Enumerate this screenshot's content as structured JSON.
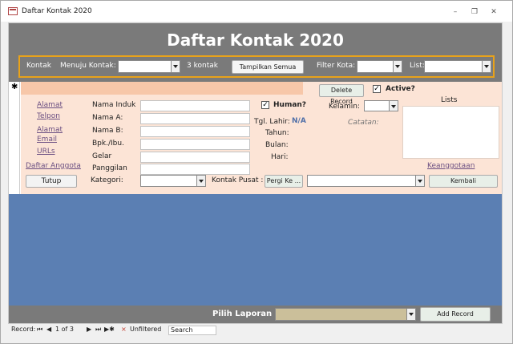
{
  "window": {
    "title": "Daftar Kontak 2020"
  },
  "header": {
    "title": "Daftar Kontak 2020",
    "kontak_label": "Kontak",
    "menuju_label": "Menuju Kontak:",
    "count_label": "3 kontak",
    "show_all_label": "Tampilkan Semua",
    "filter_kota_label": "Filter Kota:",
    "list_label": "List:"
  },
  "record": {
    "delete_label": "Delete Record",
    "active_label": "Active?",
    "lists_label": "Lists",
    "human_label": "Human?",
    "kelamin_label": "Kelamin:",
    "catatan_label": "Catatan:",
    "links": {
      "alamat": "Alamat",
      "telpon": "Telpon",
      "alamat_email": "Alamat Email",
      "urls": "URLs",
      "daftar_anggota": "Daftar Anggota",
      "keanggotaan": "Keanggotaan"
    },
    "fields": {
      "nama_induk": "Nama Induk",
      "nama_a": "Nama A:",
      "nama_b": "Nama B:",
      "bpk": "Bpk./Ibu.",
      "gelar": "Gelar",
      "panggilan": "Panggilan"
    },
    "tgl_lahir_label": "Tgl. Lahir:",
    "tgl_lahir_value": "N/A",
    "tahun_label": "Tahun:",
    "bulan_label": "Bulan:",
    "hari_label": "Hari:",
    "tutup_label": "Tutup",
    "kategori_label": "Kategori:",
    "kontak_pusat_label": "Kontak Pusat :",
    "pergi_label": "Pergi Ke ...",
    "kembali_label": "Kembali"
  },
  "footer": {
    "pilih_label": "Pilih Laporan >",
    "add_record_label": "Add Record"
  },
  "navbar": {
    "record_label": "Record:",
    "position": "1 of 3",
    "filter_label": "Unfiltered",
    "search_label": "Search"
  },
  "colors": {
    "header_gray": "#7a7a7a",
    "accent_orange": "#e8a21a",
    "record_bg": "#fce4d6",
    "empty_blue": "#5b7fb3"
  }
}
